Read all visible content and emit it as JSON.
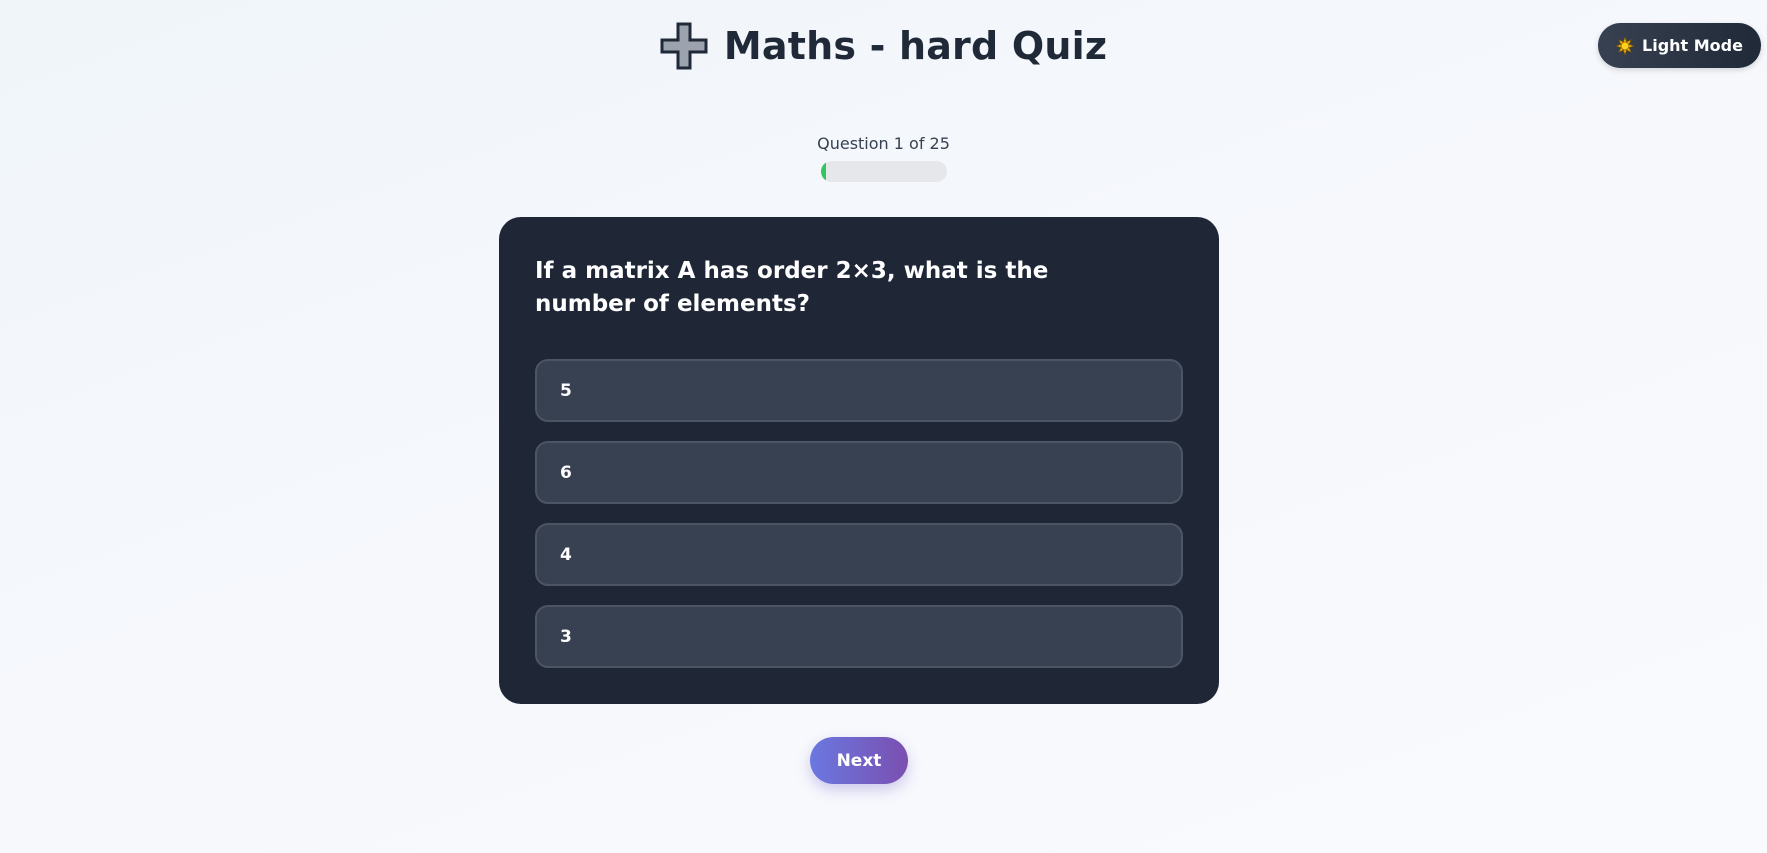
{
  "theme_toggle": {
    "icon": "sun-icon",
    "label": "Light Mode"
  },
  "header": {
    "icon": "plus-icon",
    "title": "Maths - hard Quiz"
  },
  "progress": {
    "text": "Question 1 of 25",
    "current": 1,
    "total": 25,
    "fraction": 0.04,
    "color": "#34c55e"
  },
  "quiz": {
    "question": "If a matrix A has order 2×3, what is the number of elements?",
    "options": [
      {
        "label": "5"
      },
      {
        "label": "6"
      },
      {
        "label": "4"
      },
      {
        "label": "3"
      }
    ]
  },
  "next_button": {
    "label": "Next"
  },
  "colors": {
    "card_bg": "#1f2737",
    "option_bg": "#374151",
    "option_border": "#4b5563",
    "accent_gradient_start": "#6a78e0",
    "accent_gradient_end": "#7a4fb0"
  }
}
